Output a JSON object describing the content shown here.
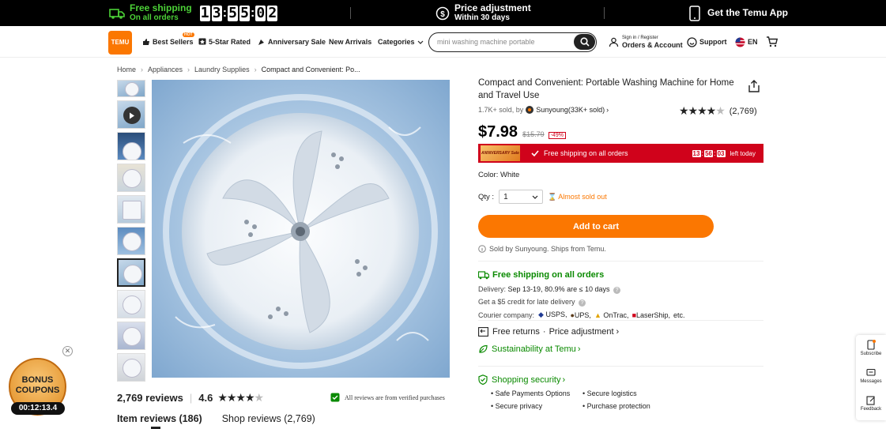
{
  "topbar": {
    "shipping_title": "Free shipping",
    "shipping_sub": "On all orders",
    "countdown": [
      "1",
      "3",
      "5",
      "5",
      "0",
      "2"
    ],
    "price_adj_title": "Price adjustment",
    "price_adj_sub": "Within 30 days",
    "app_label": "Get the Temu App"
  },
  "header": {
    "logo_line1": "TEMU",
    "nav": [
      "Best Sellers",
      "5-Star Rated",
      "Anniversary Sale",
      "New Arrivals",
      "Categories"
    ],
    "hot_badge": "HOT",
    "search_placeholder": "mini washing machine portable",
    "account_line1": "Sign in / Register",
    "account_line2": "Orders & Account",
    "support": "Support",
    "lang": "EN"
  },
  "breadcrumb": [
    "Home",
    "Appliances",
    "Laundry Supplies",
    "Compact and Convenient: Po..."
  ],
  "product": {
    "title": "Compact and Convenient: Portable Washing Machine for Home and Travel Use",
    "sold": "1.7K+ sold, by",
    "store": "Sunyoung(33K+ sold)",
    "rating_count": "(2,769)",
    "price": "$7.98",
    "was_price": "$15.79",
    "discount": "-49%",
    "promo_badge": "ANNIVERSARY Sale",
    "promo_text": "Free shipping on all orders",
    "promo_time": [
      "13",
      "56",
      "03"
    ],
    "promo_left": "left today",
    "color_label": "Color:",
    "color_value": "White",
    "qty_label": "Qty :",
    "qty_value": "1",
    "almost": "Almost sold out",
    "add_to_cart": "Add to cart",
    "sold_by": "Sold by Sunyoung. Ships from Temu."
  },
  "shipping": {
    "title": "Free shipping on all orders",
    "delivery_label": "Delivery:",
    "delivery_value": "Sep 13-19, 80.9% are ≤ 10 days",
    "credit": "Get a $5 credit for late delivery",
    "courier_label": "Courier company:",
    "couriers": [
      "USPS,",
      "UPS,",
      "OnTrac,",
      "LaserShip,",
      "etc."
    ],
    "returns": "Free returns",
    "price_adj": "Price adjustment",
    "sustain": "Sustainability at Temu",
    "security_title": "Shopping security",
    "security_items": [
      "Safe Payments Options",
      "Secure logistics",
      "Secure privacy",
      "Purchase protection"
    ]
  },
  "reviews": {
    "count": "2,769 reviews",
    "score": "4.6",
    "verified": "All reviews are from verified purchases",
    "tab1": "Item reviews (186)",
    "tab2": "Shop reviews (2,769)"
  },
  "side": [
    "Subscribe",
    "Messages",
    "Feedback"
  ],
  "bonus": {
    "line1": "BONUS",
    "line2": "COUPONS",
    "timer": "00:12:13.4"
  }
}
